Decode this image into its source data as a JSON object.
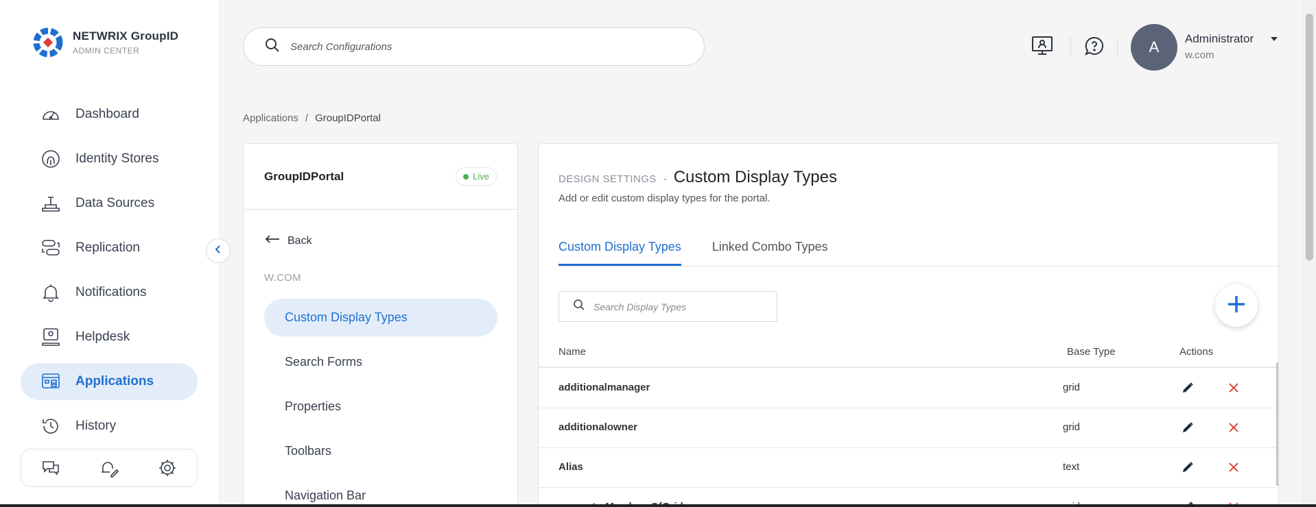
{
  "logo": {
    "title": "NETWRIX GroupID",
    "subtitle": "ADMIN CENTER"
  },
  "sidebar": {
    "items": [
      {
        "label": "Dashboard",
        "icon": "gauge-icon"
      },
      {
        "label": "Identity Stores",
        "icon": "fingerprint-icon"
      },
      {
        "label": "Data Sources",
        "icon": "database-icon"
      },
      {
        "label": "Replication",
        "icon": "replication-icon"
      },
      {
        "label": "Notifications",
        "icon": "bell-icon"
      },
      {
        "label": "Helpdesk",
        "icon": "helpdesk-icon"
      },
      {
        "label": "Applications",
        "icon": "applications-icon",
        "active": true
      },
      {
        "label": "History",
        "icon": "history-icon"
      }
    ]
  },
  "header": {
    "search_placeholder": "Search Configurations",
    "user": {
      "initial": "A",
      "name": "Administrator",
      "domain": "w.com"
    }
  },
  "breadcrumb": {
    "parent": "Applications",
    "separator": "/",
    "current": "GroupIDPortal"
  },
  "left_panel": {
    "title": "GroupIDPortal",
    "status": "Live",
    "back_label": "Back",
    "domain": "W.COM",
    "menu": [
      "Custom Display Types",
      "Search Forms",
      "Properties",
      "Toolbars",
      "Navigation Bar"
    ]
  },
  "main": {
    "section": "DESIGN SETTINGS",
    "separator": "-",
    "title": "Custom Display Types",
    "description": "Add or edit custom display types for the portal.",
    "tabs": [
      "Custom Display Types",
      "Linked Combo Types"
    ],
    "search_placeholder": "Search Display Types",
    "columns": {
      "name": "Name",
      "base_type": "Base Type",
      "actions": "Actions"
    },
    "rows": [
      {
        "name": "additionalmanager",
        "base_type": "grid"
      },
      {
        "name": "additionalowner",
        "base_type": "grid"
      },
      {
        "name": "Alias",
        "base_type": "text"
      },
      {
        "name": "computerMembersOfGrid",
        "base_type": "grid"
      }
    ]
  },
  "colors": {
    "accent": "#1f6fd1",
    "live": "#4caf50",
    "delete": "#d9342b",
    "avatar": "#5b6476"
  }
}
